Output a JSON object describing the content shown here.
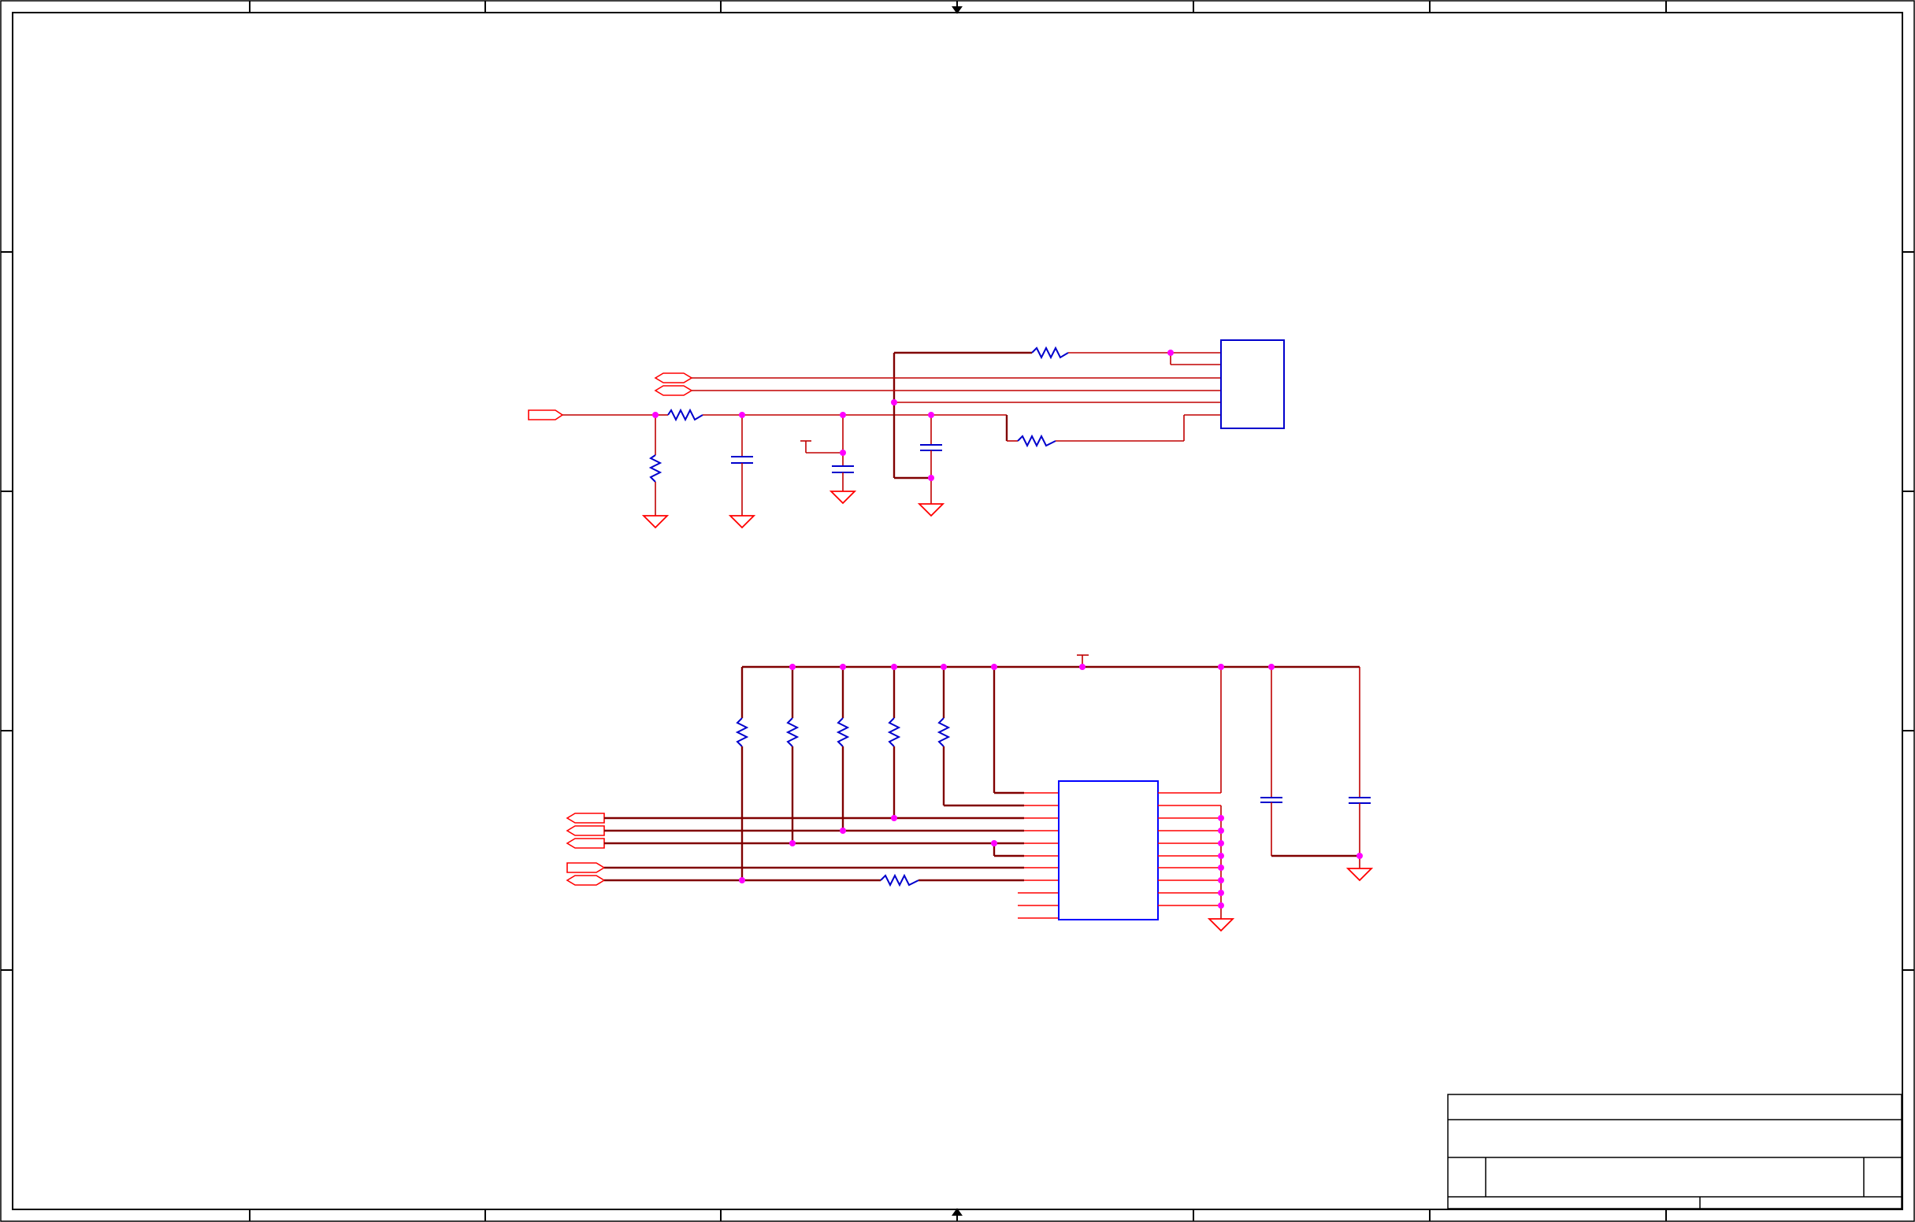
{
  "sheet": {
    "background": "#ffffff",
    "border_color": "#000000",
    "wire_color": "#c00000",
    "pin_color": "#ff0000",
    "component_color": "#0000ff",
    "junction_color": "#ff00ff",
    "title_block": {
      "title": "",
      "document_number": "",
      "revision": "",
      "size": "",
      "date": "",
      "sheet": ""
    }
  }
}
